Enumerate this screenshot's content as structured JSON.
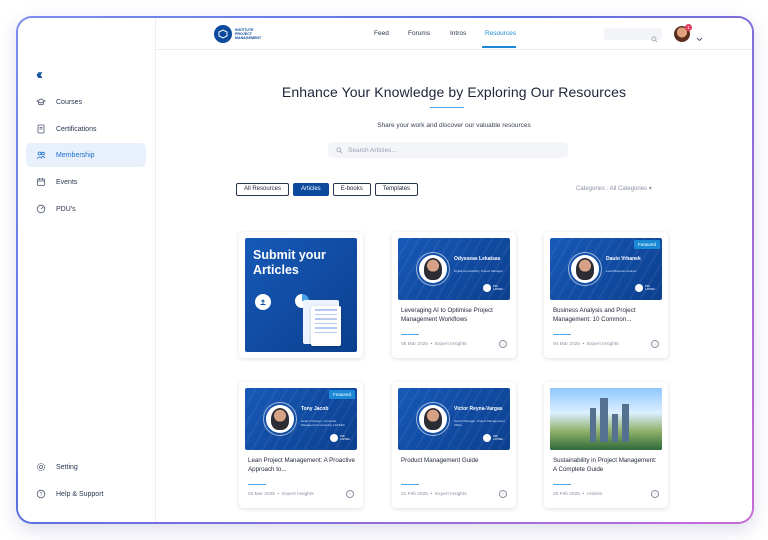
{
  "logo": {
    "text": "INSTITUTE PROJECT MANAGEMENT"
  },
  "sidebar": {
    "items": [
      {
        "label": "Courses",
        "icon": "graduation-cap-icon"
      },
      {
        "label": "Certifications",
        "icon": "certificate-icon"
      },
      {
        "label": "Membership",
        "icon": "users-icon",
        "active": true
      },
      {
        "label": "Events",
        "icon": "calendar-icon"
      },
      {
        "label": "PDU's",
        "icon": "gauge-icon"
      }
    ],
    "bottom": [
      {
        "label": "Setting",
        "icon": "gear-icon"
      },
      {
        "label": "Help & Support",
        "icon": "help-icon"
      }
    ]
  },
  "topnav": {
    "items": [
      "Feed",
      "Forums",
      "Intros",
      "Resources"
    ],
    "active": "Resources"
  },
  "user": {
    "badge": "1"
  },
  "main": {
    "headline": "Enhance Your Knowledge by Exploring Our Resources",
    "subtitle": "Share your work and discover our valuable resources",
    "search_placeholder": "Search Articles...",
    "tabs": [
      "All Resources",
      "Articles",
      "E-books",
      "Templates"
    ],
    "active_tab": "Articles",
    "category_filter": "Categories : All Categories"
  },
  "cards": [
    {
      "type": "submit",
      "title": "Submit your Articles"
    },
    {
      "type": "article",
      "person": "Odysseas Lekatsas",
      "role": "Digital Accessibility, Project Manager",
      "title": "Leveraging AI to Optimise Project Management Workflows",
      "date": "06 Mar 2025",
      "category": "Expert Insights",
      "featured": false
    },
    {
      "type": "article",
      "person": "Dauio Vrbanek",
      "role": "Lead Business Analyst",
      "title": "Business Analysis and Project Management: 10 Common...",
      "date": "04 Mar 2025",
      "category": "Expert Insights",
      "featured": true
    },
    {
      "type": "article",
      "person": "Tony Jacob",
      "role": "Head of Design, Computer Management Company LAPSEC",
      "title": "Lean Project Management: A Proactive Approach to...",
      "date": "02 Mar 2025",
      "category": "Expert Insights",
      "featured": true
    },
    {
      "type": "article",
      "person": "Victor Reyna-Vargas",
      "role": "Senior Manager, Project Management Office",
      "title": "Product Management Guide",
      "date": "21 Feb 2025",
      "category": "Expert Insights",
      "featured": false
    },
    {
      "type": "photo",
      "title": "Sustainability in Project Management: A Complete Guide",
      "date": "26 Feb 2025",
      "category": "Articles",
      "featured": false
    }
  ],
  "featured_label": "Featured",
  "pmi_label": "PMI LAPSEC",
  "colors": {
    "brand": "#0b4a9c",
    "accent": "#1b8ad6",
    "frame": "#5b6fe0"
  }
}
